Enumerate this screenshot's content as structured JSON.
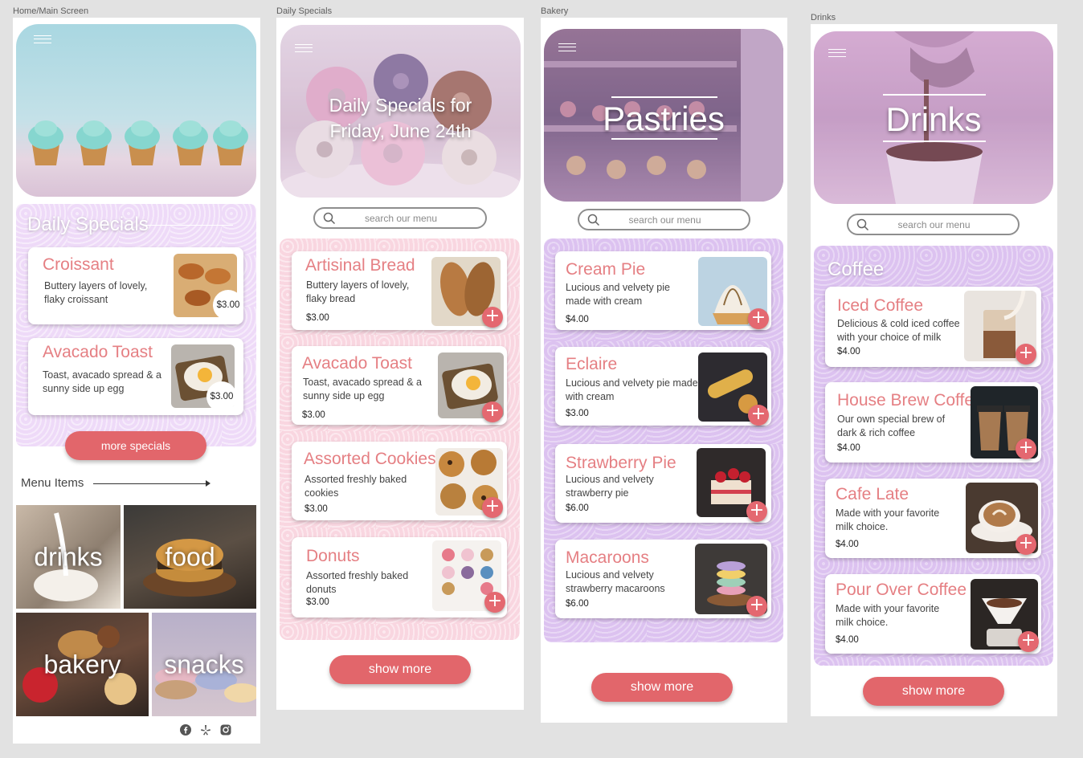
{
  "frames": {
    "home": "Home/Main Screen",
    "daily": "Daily Specials",
    "bakery": "Bakery",
    "drinks": "Drinks"
  },
  "home": {
    "section_title": "Daily Specials",
    "cards": [
      {
        "title": "Croissant",
        "desc1": "Buttery layers of lovely,",
        "desc2": "flaky croissant",
        "price": "$3.00"
      },
      {
        "title": "Avacado Toast",
        "desc1": "Toast, avacado spread & a",
        "desc2": "sunny side up egg",
        "price": "$3.00"
      }
    ],
    "more_button": "more specials",
    "menu_title": "Menu Items",
    "tiles": [
      "drinks",
      "food",
      "bakery",
      "snacks"
    ],
    "social": [
      "facebook-icon",
      "yelp-icon",
      "instagram-icon"
    ]
  },
  "daily": {
    "hero_line1": "Daily Specials for",
    "hero_line2": "Friday, June 24th",
    "search_placeholder": "search our  menu",
    "cards": [
      {
        "title": "Artisinal Bread",
        "desc1": "Buttery layers of lovely,",
        "desc2": "flaky bread",
        "price": "$3.00"
      },
      {
        "title": "Avacado Toast",
        "desc1": "Toast, avacado spread & a",
        "desc2": "sunny side up egg",
        "price": "$3.00"
      },
      {
        "title": "Assorted Cookies",
        "desc1": "Assorted freshly baked",
        "desc2": "cookies",
        "price": "$3.00"
      },
      {
        "title": "Donuts",
        "desc1": "Assorted freshly baked",
        "desc2": "donuts",
        "price": "$3.00"
      }
    ],
    "show_more": "show more"
  },
  "bakery": {
    "hero_title": "Pastries",
    "search_placeholder": "search our  menu",
    "cards": [
      {
        "title": "Cream Pie",
        "desc1": "Lucious and velvety pie",
        "desc2": "made with cream",
        "price": "$4.00"
      },
      {
        "title": "Eclaire",
        "desc1": "Lucious and velvety pie made",
        "desc2": "with cream",
        "price": "$3.00"
      },
      {
        "title": "Strawberry Pie",
        "desc1": "Lucious and velvety",
        "desc2": "strawberry pie",
        "price": "$6.00"
      },
      {
        "title": "Macaroons",
        "desc1": "Lucious and velvety",
        "desc2": "strawberry macaroons",
        "price": "$6.00"
      }
    ],
    "show_more": "show more"
  },
  "drinks": {
    "hero_title": "Drinks",
    "search_placeholder": "search our  menu",
    "section_title": "Coffee",
    "cards": [
      {
        "title": "Iced Coffee",
        "desc1": "Delicious & cold iced coffee",
        "desc2": "with your choice of milk",
        "price": "$4.00"
      },
      {
        "title": "House Brew Coffee",
        "desc1": "Our own special brew of",
        "desc2": "dark & rich coffee",
        "price": "$4.00"
      },
      {
        "title": "Cafe Late",
        "desc1": "Made with your favorite",
        "desc2": "milk choice.",
        "price": "$4.00"
      },
      {
        "title": "Pour Over Coffee",
        "desc1": "Made with your favorite",
        "desc2": "milk choice.",
        "price": "$4.00"
      }
    ],
    "show_more": "show more"
  },
  "colors": {
    "accent": "#e2666b",
    "title_pink": "#e57f83",
    "panel_pink": "#f9d6e0",
    "panel_purple": "#dcc2f0"
  }
}
